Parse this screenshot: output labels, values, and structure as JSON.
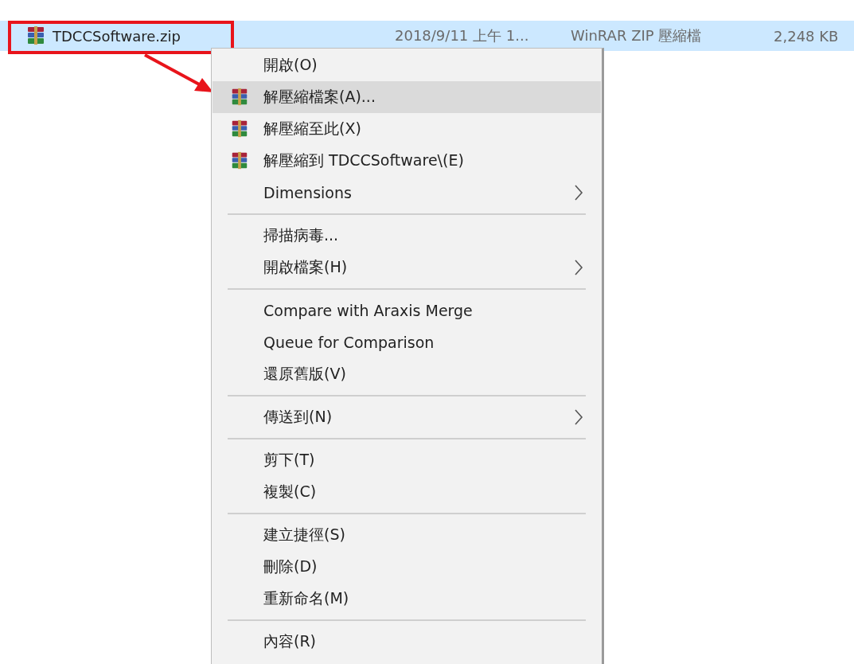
{
  "file_row": {
    "name": "TDCCSoftware.zip",
    "modified": "2018/9/11 上午 1...",
    "type": "WinRAR ZIP 壓縮檔",
    "size": "2,248 KB",
    "selected": true
  },
  "context_menu": [
    {
      "kind": "item",
      "label": "開啟(O)",
      "selected": false,
      "icon": false,
      "submenu": false
    },
    {
      "kind": "item",
      "label": "解壓縮檔案(A)...",
      "selected": true,
      "icon": true,
      "submenu": false
    },
    {
      "kind": "item",
      "label": "解壓縮至此(X)",
      "selected": false,
      "icon": true,
      "submenu": false
    },
    {
      "kind": "item",
      "label": "解壓縮到 TDCCSoftware\\(E)",
      "selected": false,
      "icon": true,
      "submenu": false
    },
    {
      "kind": "item",
      "label": "Dimensions",
      "selected": false,
      "icon": false,
      "submenu": true
    },
    {
      "kind": "separator"
    },
    {
      "kind": "item",
      "label": "掃描病毒...",
      "selected": false,
      "icon": false,
      "submenu": false
    },
    {
      "kind": "item",
      "label": "開啟檔案(H)",
      "selected": false,
      "icon": false,
      "submenu": true
    },
    {
      "kind": "separator"
    },
    {
      "kind": "item",
      "label": "Compare with Araxis Merge",
      "selected": false,
      "icon": false,
      "submenu": false
    },
    {
      "kind": "item",
      "label": "Queue for Comparison",
      "selected": false,
      "icon": false,
      "submenu": false
    },
    {
      "kind": "item",
      "label": "還原舊版(V)",
      "selected": false,
      "icon": false,
      "submenu": false
    },
    {
      "kind": "separator"
    },
    {
      "kind": "item",
      "label": "傳送到(N)",
      "selected": false,
      "icon": false,
      "submenu": true
    },
    {
      "kind": "separator"
    },
    {
      "kind": "item",
      "label": "剪下(T)",
      "selected": false,
      "icon": false,
      "submenu": false
    },
    {
      "kind": "item",
      "label": "複製(C)",
      "selected": false,
      "icon": false,
      "submenu": false
    },
    {
      "kind": "separator"
    },
    {
      "kind": "item",
      "label": "建立捷徑(S)",
      "selected": false,
      "icon": false,
      "submenu": false
    },
    {
      "kind": "item",
      "label": "刪除(D)",
      "selected": false,
      "icon": false,
      "submenu": false
    },
    {
      "kind": "item",
      "label": "重新命名(M)",
      "selected": false,
      "icon": false,
      "submenu": false
    },
    {
      "kind": "separator"
    },
    {
      "kind": "item",
      "label": "內容(R)",
      "selected": false,
      "icon": false,
      "submenu": false
    }
  ]
}
